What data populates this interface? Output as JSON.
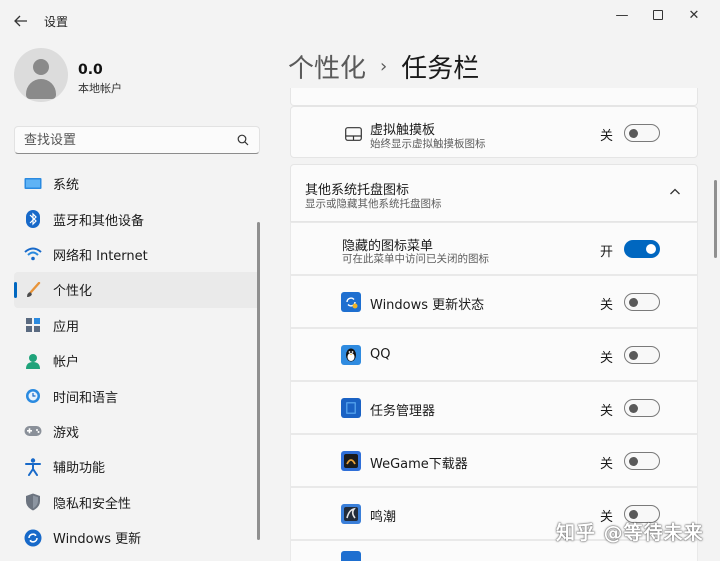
{
  "window": {
    "title": "设置",
    "back_icon": "back-arrow-icon",
    "minimize_glyph": "—",
    "close_glyph": "✕"
  },
  "user": {
    "name": "0.0",
    "account_type": "本地帐户"
  },
  "search": {
    "placeholder": "查找设置"
  },
  "nav": {
    "items": [
      {
        "label": "系统",
        "icon": "system-icon"
      },
      {
        "label": "蓝牙和其他设备",
        "icon": "bluetooth-icon"
      },
      {
        "label": "网络和 Internet",
        "icon": "network-icon"
      },
      {
        "label": "个性化",
        "icon": "personalization-brush-icon",
        "active": true
      },
      {
        "label": "应用",
        "icon": "apps-icon"
      },
      {
        "label": "帐户",
        "icon": "account-icon"
      },
      {
        "label": "时间和语言",
        "icon": "time-language-icon"
      },
      {
        "label": "游戏",
        "icon": "gaming-icon"
      },
      {
        "label": "辅助功能",
        "icon": "accessibility-icon"
      },
      {
        "label": "隐私和安全性",
        "icon": "privacy-shield-icon"
      },
      {
        "label": "Windows 更新",
        "icon": "windows-update-icon"
      }
    ]
  },
  "header": {
    "parent": "个性化",
    "separator": "›",
    "current": "任务栏"
  },
  "touchpad_row": {
    "title": "虚拟触摸板",
    "subtitle": "始终显示虚拟触摸板图标",
    "toggle_label": "关",
    "toggle_on": false
  },
  "tray_section": {
    "title": "其他系统托盘图标",
    "subtitle": "显示或隐藏其他系统托盘图标"
  },
  "hidden_menu_row": {
    "title": "隐藏的图标菜单",
    "subtitle": "可在此菜单中访问已关闭的图标",
    "toggle_label": "开",
    "toggle_on": true
  },
  "tray_apps": [
    {
      "title": "Windows 更新状态",
      "toggle_label": "关",
      "icon": "windows-update-status-icon",
      "icon_color": "#1e6fd0"
    },
    {
      "title": "QQ",
      "toggle_label": "关",
      "icon": "qq-penguin-icon",
      "icon_color": "#2f8be0"
    },
    {
      "title": "任务管理器",
      "toggle_label": "关",
      "icon": "task-manager-icon",
      "icon_color": "#1a62c4"
    },
    {
      "title": "WeGame下载器",
      "toggle_label": "关",
      "icon": "wegame-icon",
      "icon_color": "#2f6fd8"
    },
    {
      "title": "鸣潮",
      "toggle_label": "关",
      "icon": "wuthering-waves-icon",
      "icon_color": "#3a7fd9"
    }
  ],
  "watermark": "知乎 @等待未来"
}
